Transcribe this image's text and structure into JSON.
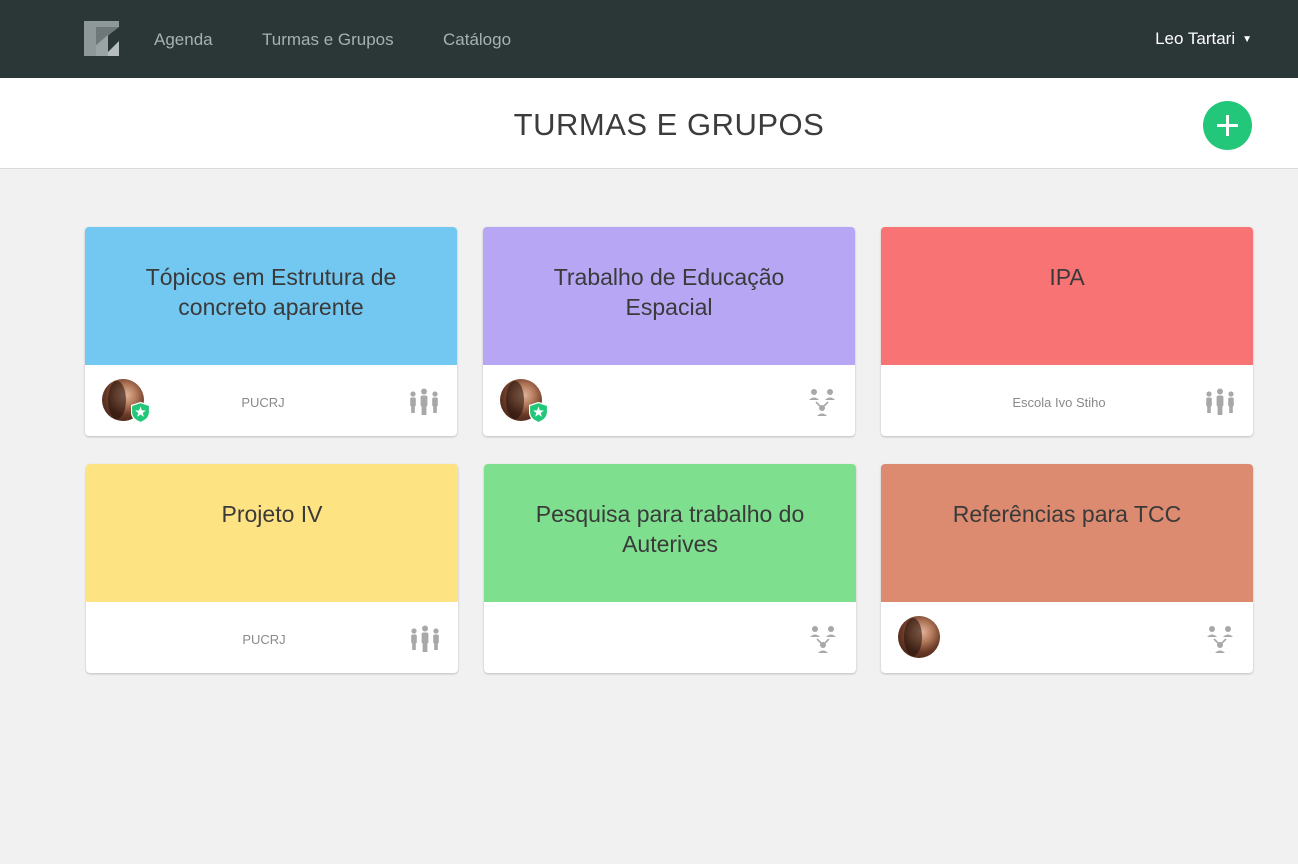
{
  "nav": {
    "items": [
      {
        "label": "Agenda"
      },
      {
        "label": "Turmas e Grupos"
      },
      {
        "label": "Catálogo"
      }
    ],
    "user_name": "Leo Tartari",
    "user_caret": "▼"
  },
  "header": {
    "title": "TURMAS E GRUPOS"
  },
  "cards": [
    {
      "title": "Tópicos em Estrutura de concreto aparente",
      "org": "PUCRJ",
      "color": "#73c8f1",
      "avatar": true,
      "owner_badge": true,
      "type_icon": "class-icon"
    },
    {
      "title": "Trabalho de Educação Espacial",
      "org": "",
      "color": "#b6a6f3",
      "avatar": true,
      "owner_badge": true,
      "type_icon": "group-icon"
    },
    {
      "title": "IPA",
      "org": "Escola Ivo Stiho",
      "color": "#f87373",
      "avatar": false,
      "owner_badge": false,
      "type_icon": "class-icon"
    },
    {
      "title": "Projeto IV",
      "org": "PUCRJ",
      "color": "#fee383",
      "avatar": false,
      "owner_badge": false,
      "type_icon": "class-icon"
    },
    {
      "title": "Pesquisa para trabalho do Auterives",
      "org": "",
      "color": "#7ee08f",
      "avatar": false,
      "owner_badge": false,
      "type_icon": "group-icon"
    },
    {
      "title": "Referências para TCC",
      "org": "",
      "color": "#dd8b70",
      "avatar": true,
      "owner_badge": false,
      "type_icon": "group-icon"
    }
  ],
  "colors": {
    "topbar": "#2b3637",
    "add_button": "#22c77a",
    "badge": "#22c77a"
  }
}
